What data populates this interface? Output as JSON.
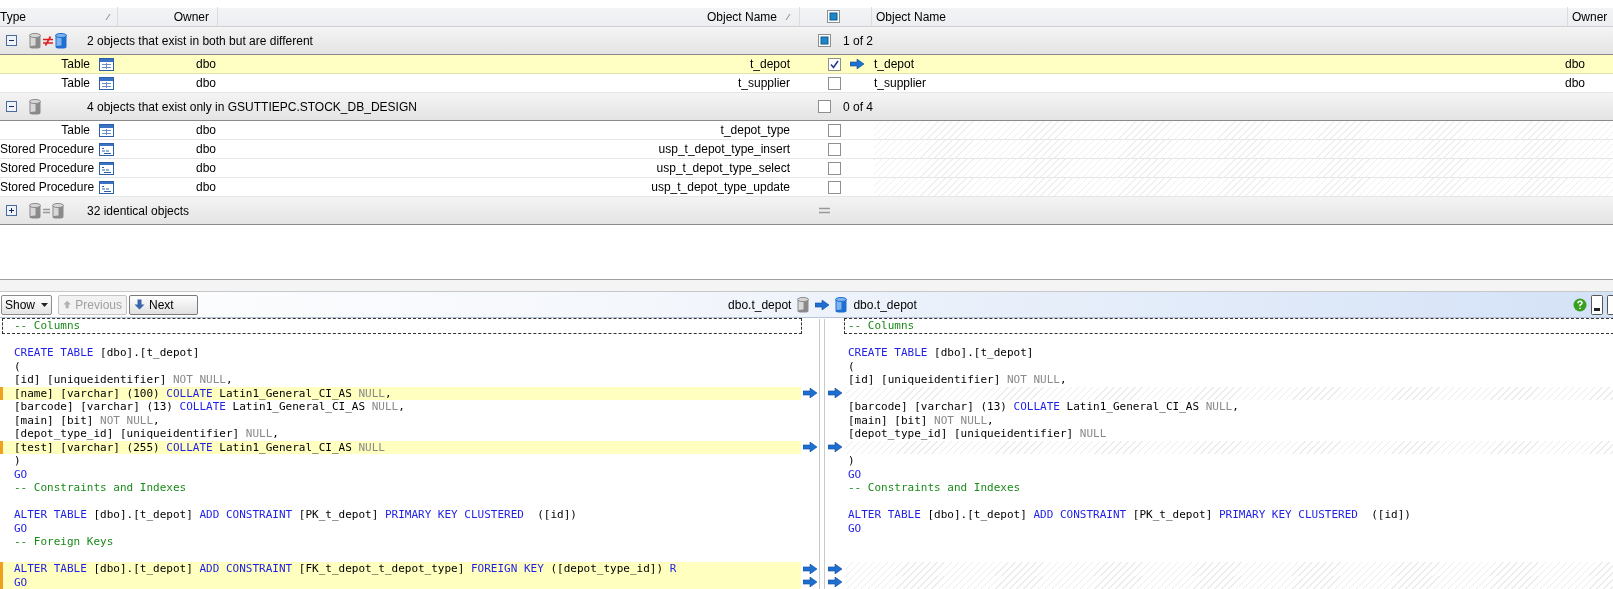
{
  "grid": {
    "columns_left": [
      "Type",
      "Owner",
      "Object Name"
    ],
    "header_partially_checked": true,
    "columns_right": [
      "Object Name",
      "Owner"
    ],
    "groups": [
      {
        "kind": "different",
        "label": "2 objects that exist in both but are different",
        "expanded": true,
        "selection": "1 of 2",
        "partially_checked": true,
        "rows": [
          {
            "kind": "table",
            "type": "Table",
            "owner": "dbo",
            "name": "t_depot",
            "checked": true,
            "selected": true,
            "right_name": "t_depot",
            "right_owner": "dbo"
          },
          {
            "kind": "table",
            "type": "Table",
            "owner": "dbo",
            "name": "t_supplier",
            "checked": false,
            "selected": false,
            "right_name": "t_supplier",
            "right_owner": "dbo"
          }
        ]
      },
      {
        "kind": "only_left",
        "label": "4 objects that exist only in GSUTTIEPC.STOCK_DB_DESIGN",
        "expanded": true,
        "selection": "0 of 4",
        "partially_checked": false,
        "rows": [
          {
            "kind": "table",
            "type": "Table",
            "owner": "dbo",
            "name": "t_depot_type",
            "checked": false,
            "selected": false
          },
          {
            "kind": "procedure",
            "type": "Stored Procedure",
            "owner": "dbo",
            "name": "usp_t_depot_type_insert",
            "checked": false,
            "selected": false
          },
          {
            "kind": "procedure",
            "type": "Stored Procedure",
            "owner": "dbo",
            "name": "usp_t_depot_type_select",
            "checked": false,
            "selected": false
          },
          {
            "kind": "procedure",
            "type": "Stored Procedure",
            "owner": "dbo",
            "name": "usp_t_depot_type_update",
            "checked": false,
            "selected": false
          }
        ]
      },
      {
        "kind": "identical",
        "label": "32 identical objects",
        "expanded": false
      }
    ]
  },
  "toolbar": {
    "show": "Show",
    "buttons": [
      {
        "kind": "previous",
        "label": "Previous",
        "disabled": true
      },
      {
        "kind": "next",
        "label": "Next",
        "disabled": false
      }
    ],
    "left_object": "dbo.t_depot",
    "right_object": "dbo.t_depot"
  },
  "panes": [
    {
      "lines": [
        {
          "kind": "code",
          "changed": false,
          "focused": true,
          "segments": [
            {
              "kind": "comment",
              "text": "-- Columns"
            }
          ]
        },
        {
          "kind": "code",
          "changed": false
        },
        {
          "kind": "code",
          "changed": false,
          "segments": [
            {
              "kind": "keyword",
              "text": "CREATE TABLE"
            },
            {
              "kind": "text",
              "text": " [dbo].[t_depot]"
            }
          ]
        },
        {
          "kind": "code",
          "changed": false,
          "segments": [
            {
              "kind": "text",
              "text": "("
            }
          ]
        },
        {
          "kind": "code",
          "changed": false,
          "segments": [
            {
              "kind": "text",
              "text": "[id] [uniqueidentifier] "
            },
            {
              "kind": "null",
              "text": "NOT NULL"
            },
            {
              "kind": "text",
              "text": ","
            }
          ]
        },
        {
          "kind": "code",
          "changed": true,
          "segments": [
            {
              "kind": "text",
              "text": "[name] [varchar] (100) "
            },
            {
              "kind": "keyword",
              "text": "COLLATE"
            },
            {
              "kind": "text",
              "text": " Latin1_General_CI_AS "
            },
            {
              "kind": "null",
              "text": "NULL"
            },
            {
              "kind": "text",
              "text": ","
            }
          ]
        },
        {
          "kind": "code",
          "changed": false,
          "segments": [
            {
              "kind": "text",
              "text": "[barcode] [varchar] (13) "
            },
            {
              "kind": "keyword",
              "text": "COLLATE"
            },
            {
              "kind": "text",
              "text": " Latin1_General_CI_AS "
            },
            {
              "kind": "null",
              "text": "NULL"
            },
            {
              "kind": "text",
              "text": ","
            }
          ]
        },
        {
          "kind": "code",
          "changed": false,
          "segments": [
            {
              "kind": "text",
              "text": "[main] [bit] "
            },
            {
              "kind": "null",
              "text": "NOT NULL"
            },
            {
              "kind": "text",
              "text": ","
            }
          ]
        },
        {
          "kind": "code",
          "changed": false,
          "segments": [
            {
              "kind": "text",
              "text": "[depot_type_id] [uniqueidentifier] "
            },
            {
              "kind": "null",
              "text": "NULL"
            },
            {
              "kind": "text",
              "text": ","
            }
          ]
        },
        {
          "kind": "code",
          "changed": true,
          "segments": [
            {
              "kind": "text",
              "text": "[test] [varchar] (255) "
            },
            {
              "kind": "keyword",
              "text": "COLLATE"
            },
            {
              "kind": "text",
              "text": " Latin1_General_CI_AS "
            },
            {
              "kind": "null",
              "text": "NULL"
            }
          ]
        },
        {
          "kind": "code",
          "changed": false,
          "segments": [
            {
              "kind": "text",
              "text": ")"
            }
          ]
        },
        {
          "kind": "code",
          "changed": false,
          "segments": [
            {
              "kind": "keyword",
              "text": "GO"
            }
          ]
        },
        {
          "kind": "code",
          "changed": false,
          "segments": [
            {
              "kind": "comment",
              "text": "-- Constraints and Indexes"
            }
          ]
        },
        {
          "kind": "code",
          "changed": false
        },
        {
          "kind": "code",
          "changed": false,
          "segments": [
            {
              "kind": "keyword",
              "text": "ALTER TABLE"
            },
            {
              "kind": "text",
              "text": " [dbo].[t_depot] "
            },
            {
              "kind": "keyword",
              "text": "ADD CONSTRAINT"
            },
            {
              "kind": "text",
              "text": " [PK_t_depot] "
            },
            {
              "kind": "keyword",
              "text": "PRIMARY KEY CLUSTERED"
            },
            {
              "kind": "text",
              "text": "  ([id])"
            }
          ]
        },
        {
          "kind": "code",
          "changed": false,
          "segments": [
            {
              "kind": "keyword",
              "text": "GO"
            }
          ]
        },
        {
          "kind": "code",
          "changed": false,
          "segments": [
            {
              "kind": "comment",
              "text": "-- Foreign Keys"
            }
          ]
        },
        {
          "kind": "code",
          "changed": false
        },
        {
          "kind": "code",
          "changed": true,
          "segments": [
            {
              "kind": "keyword",
              "text": "ALTER TABLE"
            },
            {
              "kind": "text",
              "text": " [dbo].[t_depot] "
            },
            {
              "kind": "keyword",
              "text": "ADD CONSTRAINT"
            },
            {
              "kind": "text",
              "text": " [FK_t_depot_t_depot_type] "
            },
            {
              "kind": "keyword",
              "text": "FOREIGN KEY"
            },
            {
              "kind": "text",
              "text": " ([depot_type_id]) "
            },
            {
              "kind": "keyword",
              "text": "R"
            }
          ]
        },
        {
          "kind": "code",
          "changed": true,
          "segments": [
            {
              "kind": "keyword",
              "text": "GO"
            }
          ]
        }
      ]
    },
    {
      "lines": [
        {
          "kind": "code",
          "changed": false,
          "focused": true,
          "segments": [
            {
              "kind": "comment",
              "text": "-- Columns"
            }
          ]
        },
        {
          "kind": "code",
          "changed": false
        },
        {
          "kind": "code",
          "changed": false,
          "segments": [
            {
              "kind": "keyword",
              "text": "CREATE TABLE"
            },
            {
              "kind": "text",
              "text": " [dbo].[t_depot]"
            }
          ]
        },
        {
          "kind": "code",
          "changed": false,
          "segments": [
            {
              "kind": "text",
              "text": "("
            }
          ]
        },
        {
          "kind": "code",
          "changed": false,
          "segments": [
            {
              "kind": "text",
              "text": "[id] [uniqueidentifier] "
            },
            {
              "kind": "null",
              "text": "NOT NULL"
            },
            {
              "kind": "text",
              "text": ","
            }
          ]
        },
        {
          "kind": "gap",
          "changed": true
        },
        {
          "kind": "code",
          "changed": false,
          "segments": [
            {
              "kind": "text",
              "text": "[barcode] [varchar] (13) "
            },
            {
              "kind": "keyword",
              "text": "COLLATE"
            },
            {
              "kind": "text",
              "text": " Latin1_General_CI_AS "
            },
            {
              "kind": "null",
              "text": "NULL"
            },
            {
              "kind": "text",
              "text": ","
            }
          ]
        },
        {
          "kind": "code",
          "changed": false,
          "segments": [
            {
              "kind": "text",
              "text": "[main] [bit] "
            },
            {
              "kind": "null",
              "text": "NOT NULL"
            },
            {
              "kind": "text",
              "text": ","
            }
          ]
        },
        {
          "kind": "code",
          "changed": false,
          "segments": [
            {
              "kind": "text",
              "text": "[depot_type_id] [uniqueidentifier] "
            },
            {
              "kind": "null",
              "text": "NULL"
            }
          ]
        },
        {
          "kind": "gap",
          "changed": true
        },
        {
          "kind": "code",
          "changed": false,
          "segments": [
            {
              "kind": "text",
              "text": ")"
            }
          ]
        },
        {
          "kind": "code",
          "changed": false,
          "segments": [
            {
              "kind": "keyword",
              "text": "GO"
            }
          ]
        },
        {
          "kind": "code",
          "changed": false,
          "segments": [
            {
              "kind": "comment",
              "text": "-- Constraints and Indexes"
            }
          ]
        },
        {
          "kind": "code",
          "changed": false
        },
        {
          "kind": "code",
          "changed": false,
          "segments": [
            {
              "kind": "keyword",
              "text": "ALTER TABLE"
            },
            {
              "kind": "text",
              "text": " [dbo].[t_depot] "
            },
            {
              "kind": "keyword",
              "text": "ADD CONSTRAINT"
            },
            {
              "kind": "text",
              "text": " [PK_t_depot] "
            },
            {
              "kind": "keyword",
              "text": "PRIMARY KEY CLUSTERED"
            },
            {
              "kind": "text",
              "text": "  ([id])"
            }
          ]
        },
        {
          "kind": "code",
          "changed": false,
          "segments": [
            {
              "kind": "keyword",
              "text": "GO"
            }
          ]
        },
        {
          "kind": "code",
          "changed": false
        },
        {
          "kind": "code",
          "changed": false
        },
        {
          "kind": "gap",
          "changed": true
        },
        {
          "kind": "gap",
          "changed": true
        }
      ]
    }
  ]
}
